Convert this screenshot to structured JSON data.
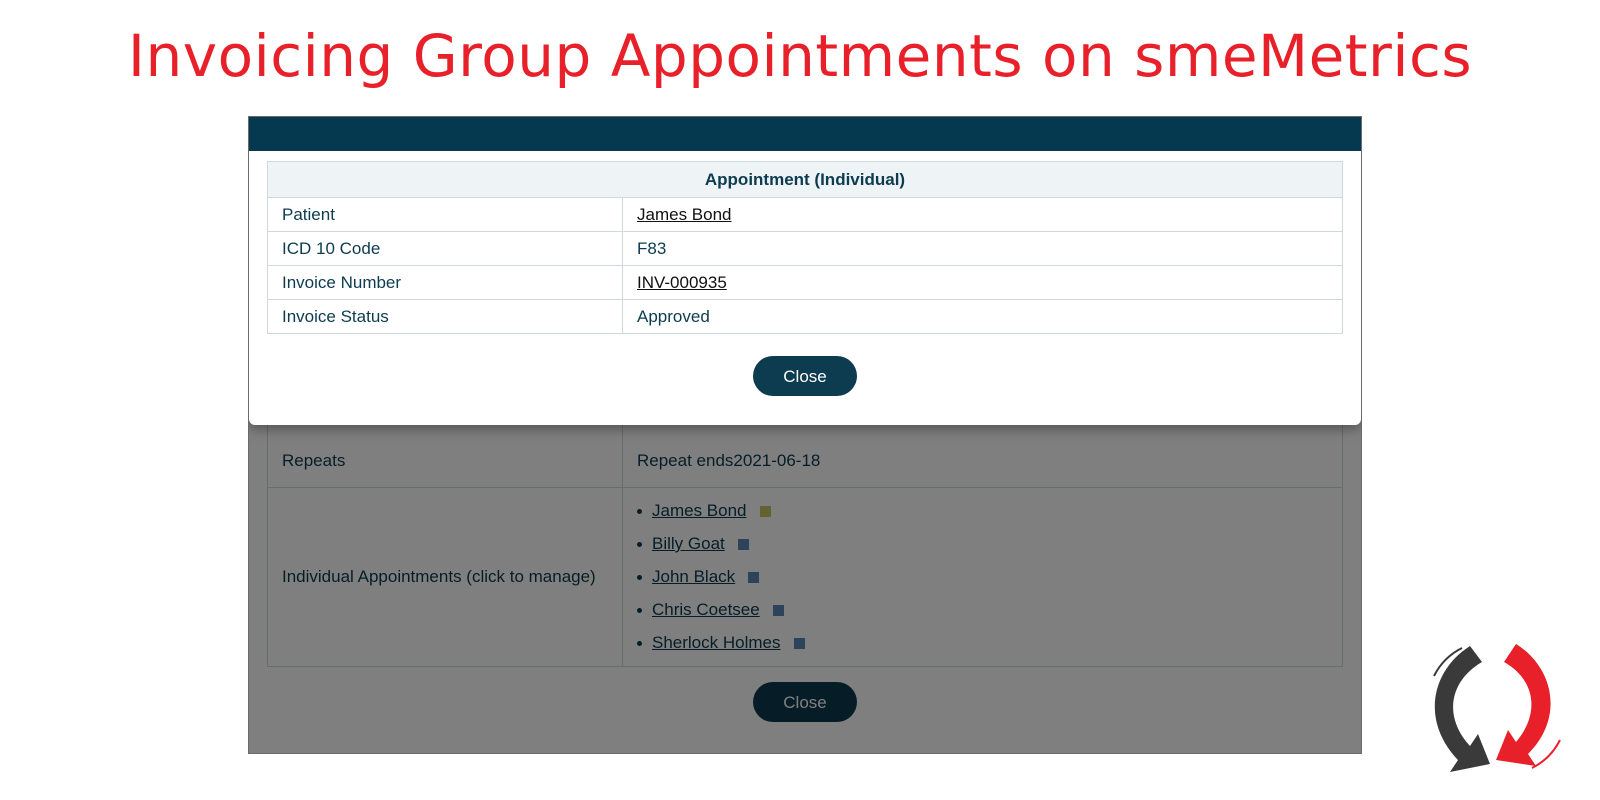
{
  "slide": {
    "title": "Invoicing Group Appointments on smeMetrics"
  },
  "background": {
    "repeats_label": "Repeats",
    "repeat_ends_label": "Repeat ends",
    "repeat_ends_value": "2021-06-18",
    "appointments_label": "Individual Appointments (click to manage)",
    "appointments": [
      {
        "name": "James Bond",
        "color": "#c3c862"
      },
      {
        "name": "Billy Goat",
        "color": "#5a86b8"
      },
      {
        "name": "John Black",
        "color": "#5a86b8"
      },
      {
        "name": "Chris Coetsee",
        "color": "#5a86b8"
      },
      {
        "name": "Sherlock Holmes ",
        "color": "#5a86b8"
      }
    ],
    "close_label": "Close"
  },
  "modal": {
    "table_title": "Appointment (Individual)",
    "rows": [
      {
        "label": "Patient",
        "value": "James Bond",
        "link": true
      },
      {
        "label": "ICD 10 Code",
        "value": "F83",
        "link": false
      },
      {
        "label": "Invoice Number",
        "value": "INV-000935",
        "link": true
      },
      {
        "label": "Invoice Status",
        "value": "Approved",
        "link": false
      }
    ],
    "close_label": "Close"
  },
  "colors": {
    "title": "#e8202a",
    "header": "#04394f",
    "button": "#0d3b4f"
  },
  "icons": {
    "logo": "smemetrics-logo-icon"
  }
}
